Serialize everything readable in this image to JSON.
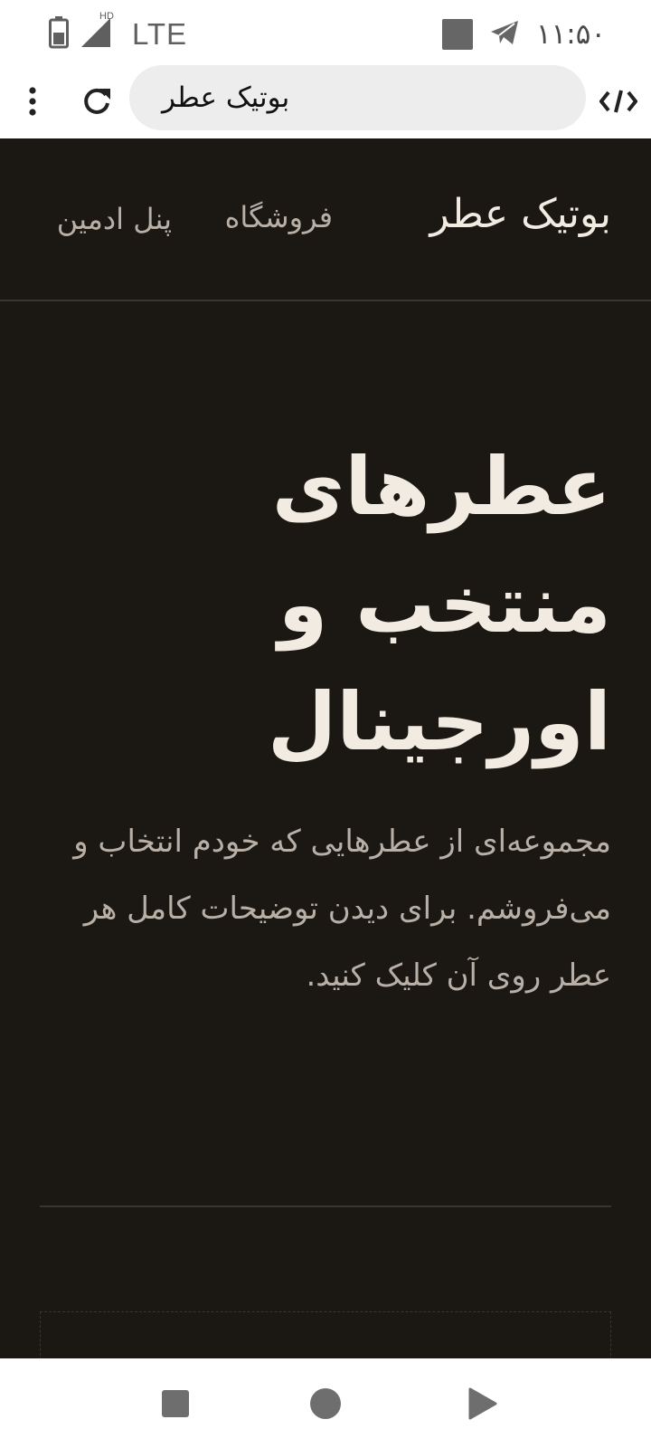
{
  "status_bar": {
    "network": "LTE",
    "hd_label": "HD",
    "time": "۱۱:۵۰"
  },
  "browser": {
    "url_text": "بوتیک عطر"
  },
  "site": {
    "logo": "بوتیک عطر",
    "nav": {
      "shop": "فروشگاه",
      "admin": "پنل ادمین"
    }
  },
  "hero": {
    "title": "عطرهای منتخب و اورجینال",
    "description": "مجموعه‌ای از عطرهایی که خودم انتخاب و می‌فروشم. برای دیدن توضیحات کامل هر عطر روی آن کلیک کنید."
  },
  "colors": {
    "page_bg": "#1b1713",
    "title_text": "#f1ebe1",
    "muted_text": "#b8b0a6",
    "divider": "#3a3530"
  },
  "icons": {
    "battery": "battery-icon",
    "signal": "signal-icon",
    "notification": "notification-square-icon",
    "telegram": "telegram-icon",
    "menu": "more-vert-icon",
    "reload": "reload-icon",
    "extension": "code-extension-icon",
    "recents": "recents-square-icon",
    "home": "home-circle-icon",
    "back": "back-triangle-icon"
  }
}
